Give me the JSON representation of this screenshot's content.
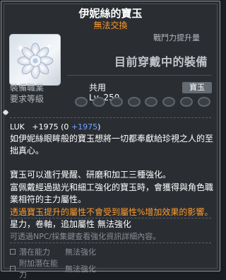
{
  "tooltip": {
    "title": "伊妮絲的寶玉",
    "trade_status": "無法交換",
    "power_label": "戰鬥力提升量",
    "equipped_text": "目前穿戴中的裝備",
    "slot_badge": "寶玉",
    "icon": "white-jewel-flower-icon",
    "job_label": "裝備職業",
    "job_value": "共用",
    "level_label": "要求等級",
    "level_value": "Lv. 250",
    "stat": {
      "name": "LUK",
      "total": "+1975",
      "breakdown_open": "(0 ",
      "breakdown_value": "+1975",
      "breakdown_close": ")"
    },
    "description": "如伊妮絲眼眸般的寶玉想將一切都奉獻給珍視之人的至拙真心。",
    "info_line1": "寶玉可以進行覺醒、研磨和加工三種強化。",
    "info_line2": "富佩戴經過拋光和細工強化的寶玉時，會獲得與角色職業相符的主力屬性。",
    "warning": "透過寶玉提升的屬性不會受到屬性%增加效果的影響。",
    "enhance_line": "星力，卷軸，追加屬性 無法強化",
    "hint": "可透過NPC/採集鍵查看強化資訊詳細內容。",
    "potential_label": "潛在能力",
    "potential_value": "無法強化",
    "bonus_potential_label": "附加潛在能力",
    "bonus_potential_value": "無法強化"
  },
  "colors": {
    "background": "#2a2e33",
    "orange": "#ff9a2a",
    "blue": "#6fa3ff",
    "grey": "#8a8e93"
  }
}
